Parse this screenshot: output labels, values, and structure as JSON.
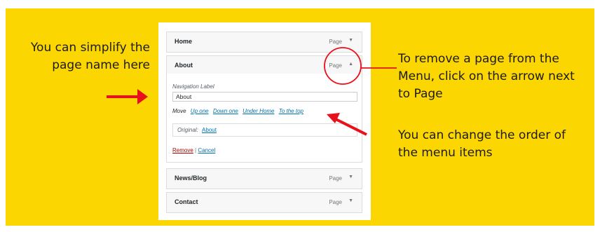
{
  "notes": {
    "left": "You can simplify the page name here",
    "remove": "To remove a page from the Menu, click on the arrow next to Page",
    "order": "You can change the order of the menu items"
  },
  "menu_items": [
    {
      "title": "Home",
      "type": "Page"
    },
    {
      "title": "About",
      "type": "Page"
    },
    {
      "title": "News/Blog",
      "type": "Page"
    },
    {
      "title": "Contact",
      "type": "Page"
    }
  ],
  "settings": {
    "nav_label_caption": "Navigation Label",
    "nav_label_value": "About",
    "move_label": "Move",
    "move_links": [
      "Up one",
      "Down one",
      "Under Home",
      "To the top"
    ],
    "original_caption": "Original:",
    "original_link": "About",
    "remove_label": "Remove",
    "separator": "|",
    "cancel_label": "Cancel"
  },
  "colors": {
    "background": "#fcd600",
    "annotation": "#e8111b",
    "link": "#0073aa"
  }
}
